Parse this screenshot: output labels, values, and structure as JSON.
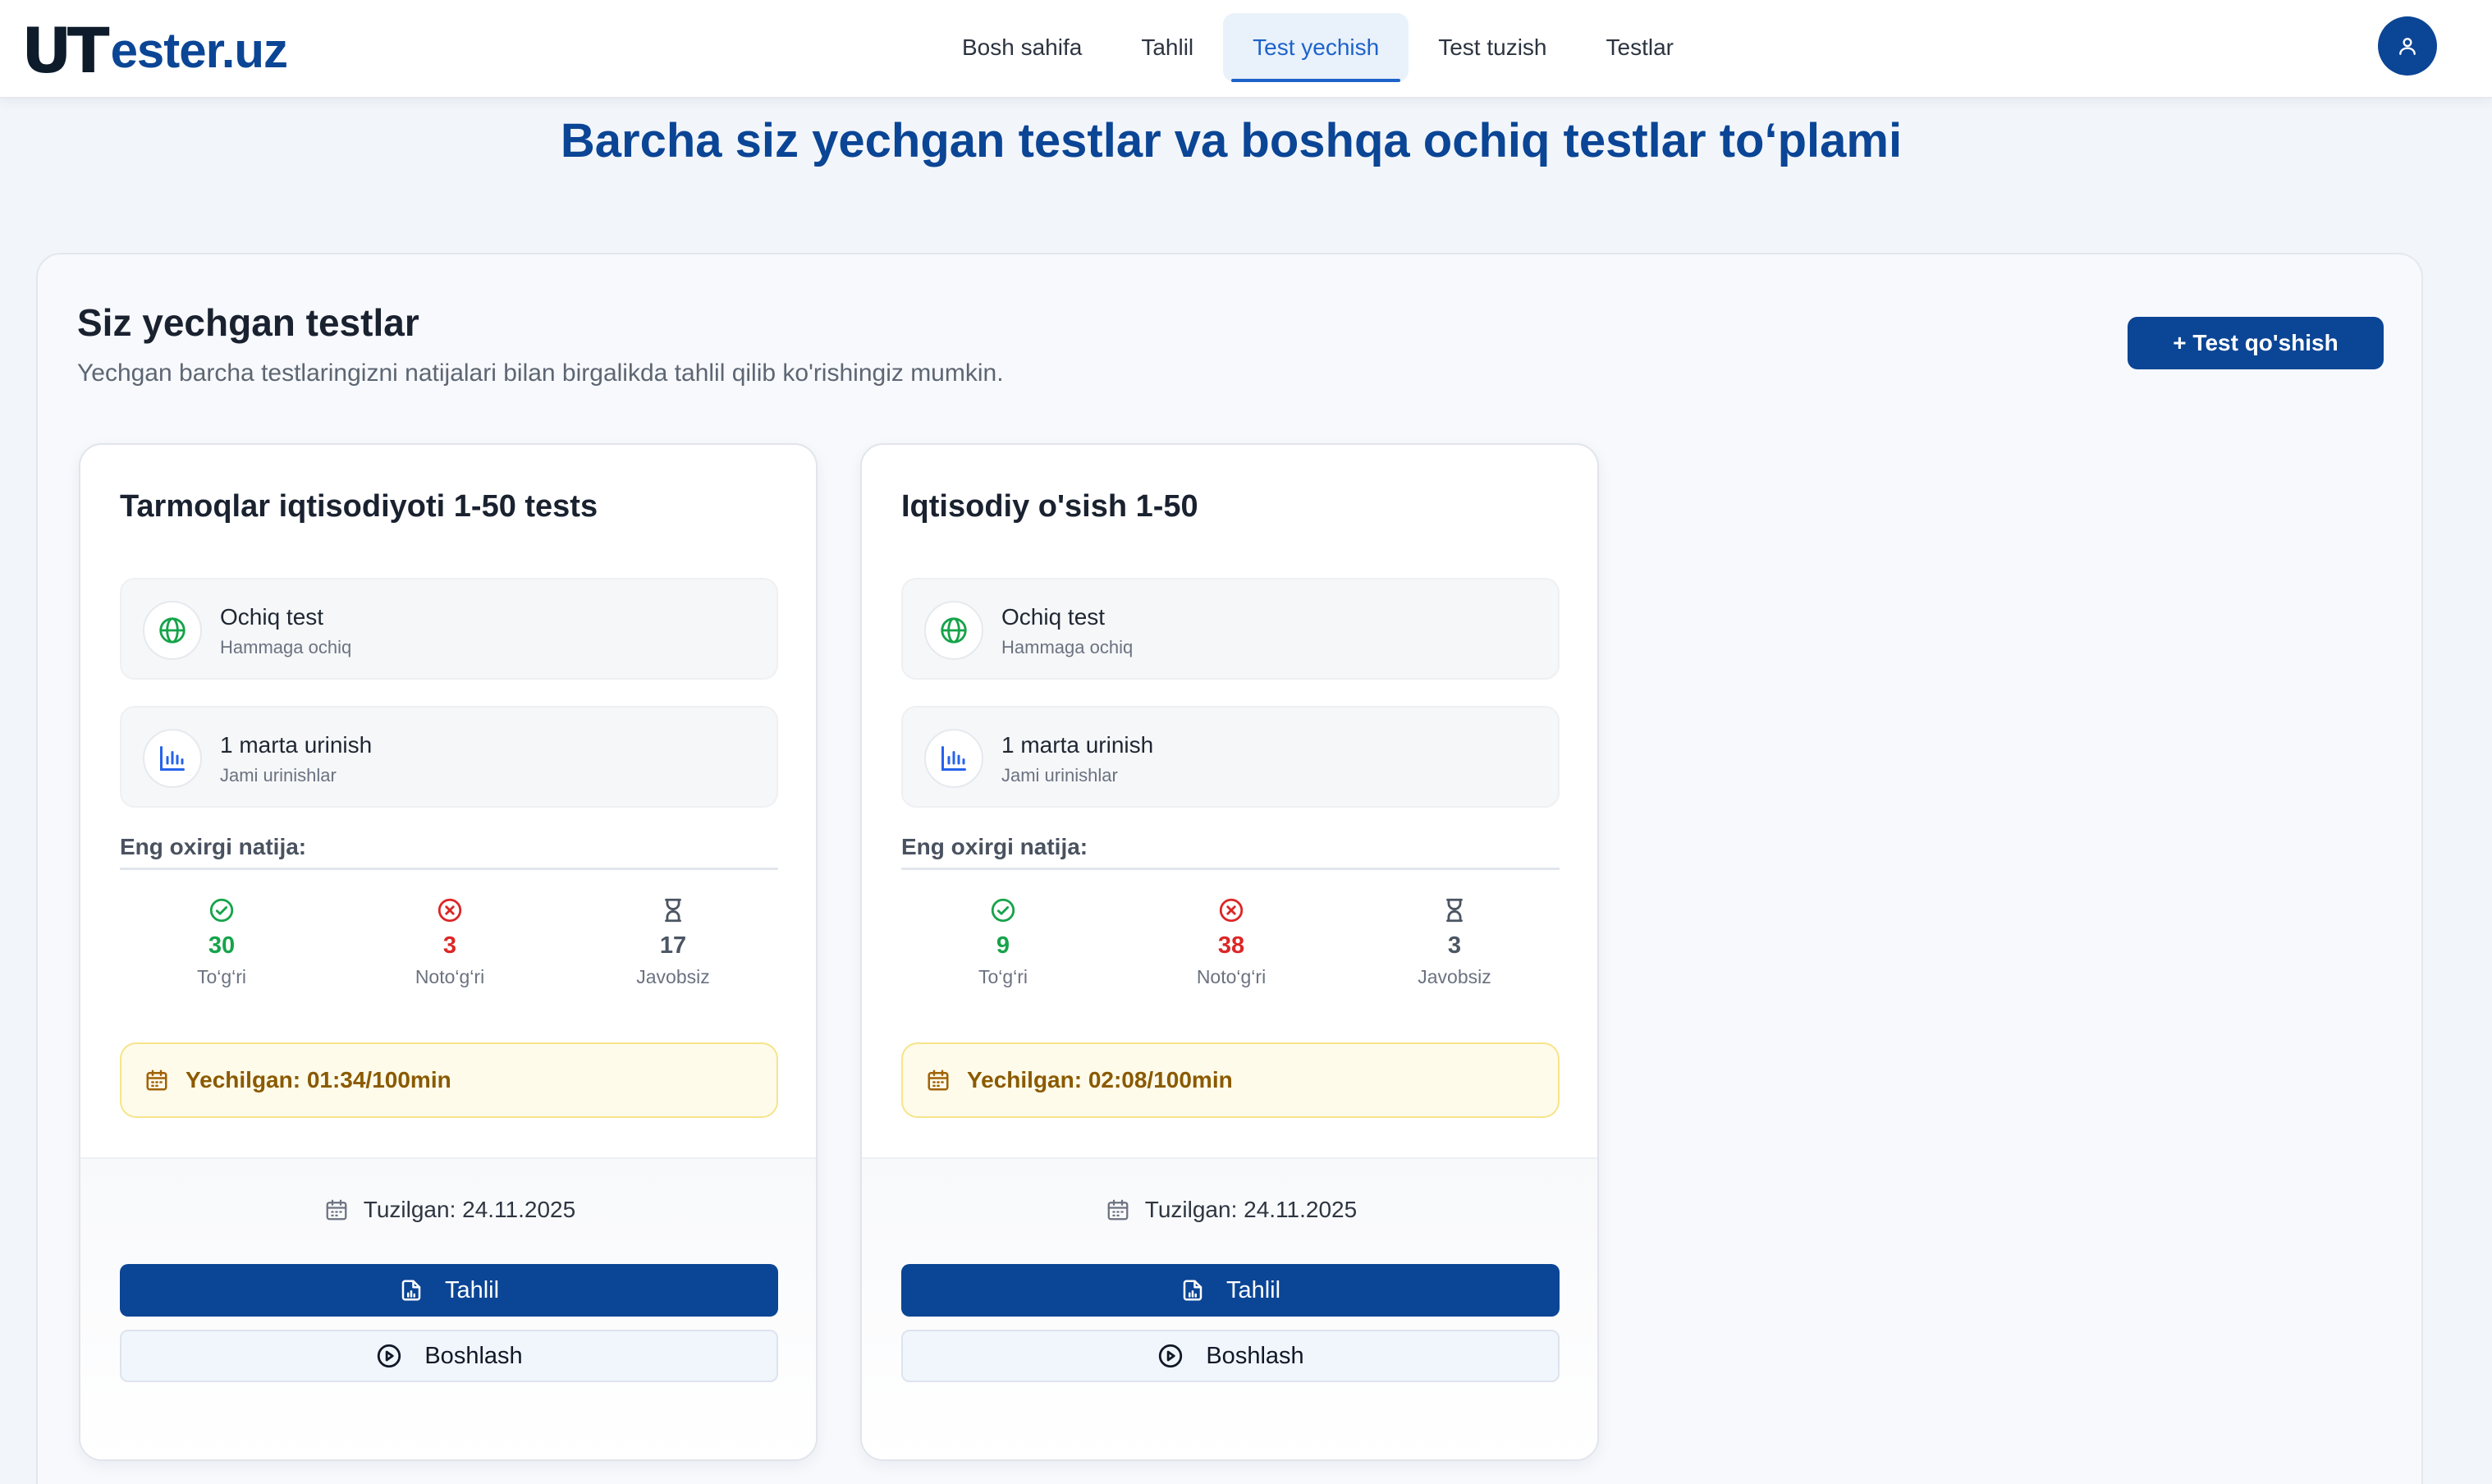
{
  "header": {
    "logo_u": "U",
    "logo_t": "T",
    "logo_rest": "ester.uz",
    "nav": [
      {
        "label": "Bosh sahifa"
      },
      {
        "label": "Tahlil"
      },
      {
        "label": "Test yechish",
        "active": true
      },
      {
        "label": "Test tuzish"
      },
      {
        "label": "Testlar"
      }
    ],
    "avatar_icon": "user-icon"
  },
  "page_title": "Barcha siz yechgan testlar va boshqa ochiq testlar to‘plami",
  "section": {
    "title": "Siz yechgan testlar",
    "subtitle": "Yechgan barcha testlaringizni natijalari bilan birgalikda tahlil qilib ko'rishingiz mumkin.",
    "add_button": "+ Test qo'shish"
  },
  "colors": {
    "primary": "#0b4595",
    "correct": "#16a34a",
    "incorrect": "#dc2626",
    "time_bg": "#fffbea"
  },
  "cards": [
    {
      "title": "Tarmoqlar iqtisodiyoti 1-50 tests",
      "access": {
        "label": "Ochiq test",
        "sub": "Hammaga ochiq",
        "icon": "globe-icon"
      },
      "attempts": {
        "label": "1 marta urinish",
        "sub": "Jami urinishlar",
        "icon": "bar-chart-icon"
      },
      "result_label": "Eng oxirgi natija:",
      "stats": {
        "correct": "30",
        "correct_label": "To‘g‘ri",
        "incorrect": "3",
        "incorrect_label": "Noto‘g‘ri",
        "unanswered": "17",
        "unanswered_label": "Javobsiz"
      },
      "solved": "Yechilgan: 01:34/100min",
      "created": "Tuzilgan: 24.11.2025",
      "analyze_button": "Tahlil",
      "start_button": "Boshlash"
    },
    {
      "title": "Iqtisodiy o'sish 1-50",
      "access": {
        "label": "Ochiq test",
        "sub": "Hammaga ochiq",
        "icon": "globe-icon"
      },
      "attempts": {
        "label": "1 marta urinish",
        "sub": "Jami urinishlar",
        "icon": "bar-chart-icon"
      },
      "result_label": "Eng oxirgi natija:",
      "stats": {
        "correct": "9",
        "correct_label": "To‘g‘ri",
        "incorrect": "38",
        "incorrect_label": "Noto‘g‘ri",
        "unanswered": "3",
        "unanswered_label": "Javobsiz"
      },
      "solved": "Yechilgan: 02:08/100min",
      "created": "Tuzilgan: 24.11.2025",
      "analyze_button": "Tahlil",
      "start_button": "Boshlash"
    }
  ]
}
